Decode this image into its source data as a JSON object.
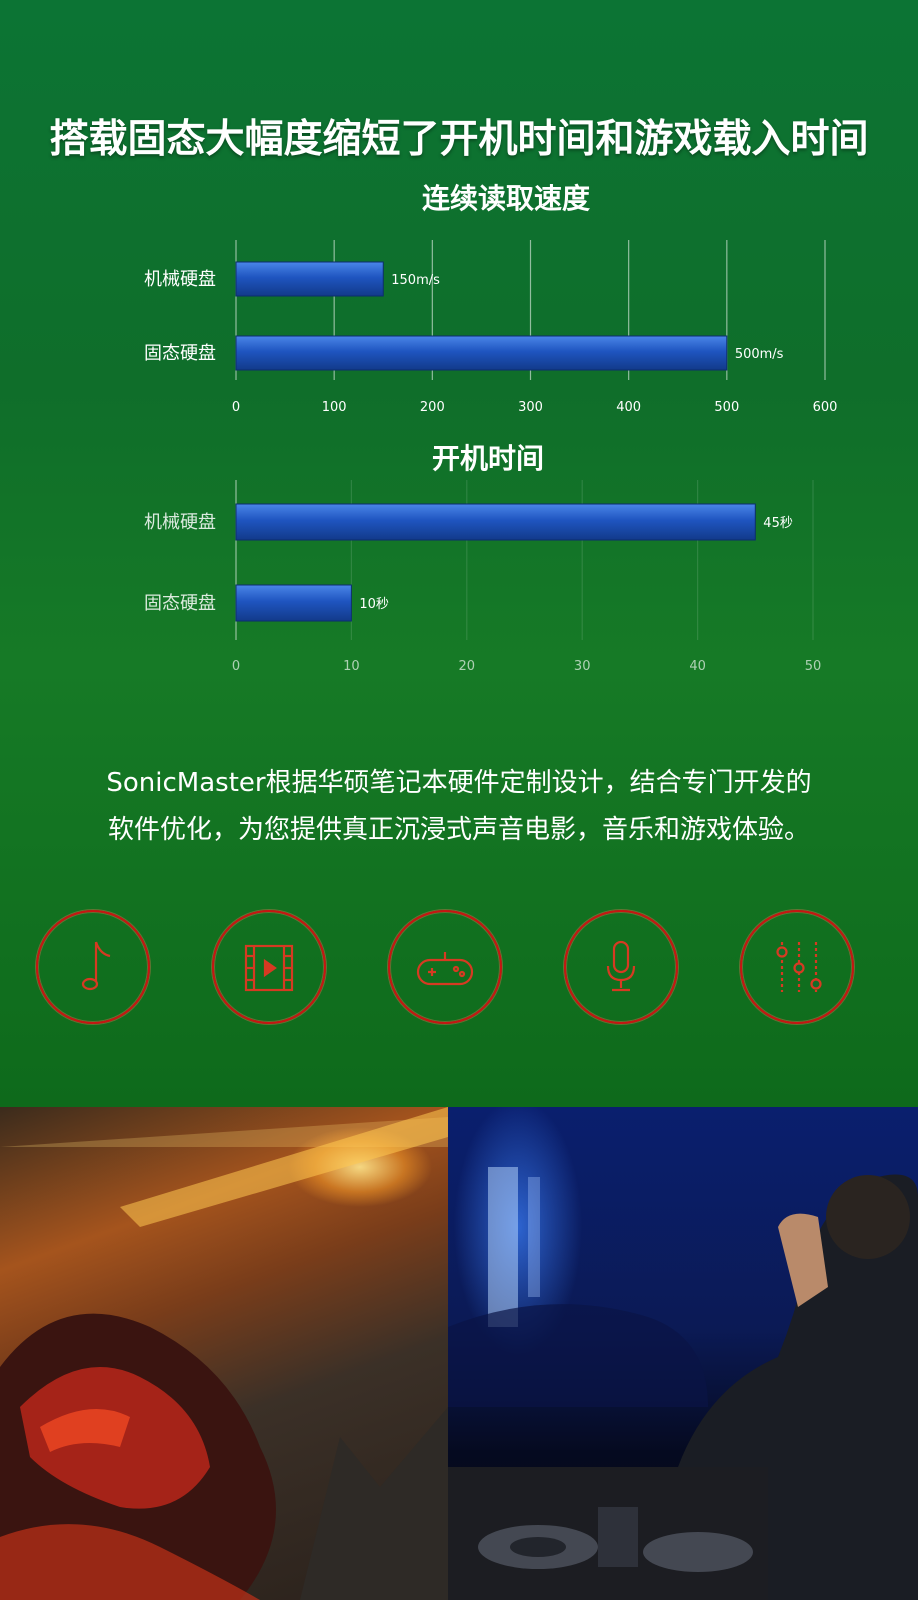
{
  "headline": "搭载固态大幅度缩短了开机时间和游戏载入时间",
  "chart_data": [
    {
      "type": "bar",
      "orientation": "horizontal",
      "title": "连续读取速度",
      "categories": [
        "机械硬盘",
        "固态硬盘"
      ],
      "values": [
        150,
        500
      ],
      "value_labels": [
        "150m/s",
        "500m/s"
      ],
      "xlim": [
        0,
        600
      ],
      "ticks": [
        "0",
        "100",
        "200",
        "300",
        "400",
        "500",
        "600"
      ],
      "bar_color": "#1f55c0",
      "grid": true
    },
    {
      "type": "bar",
      "orientation": "horizontal",
      "title": "开机时间",
      "categories": [
        "机械硬盘",
        "固态硬盘"
      ],
      "values": [
        45,
        10
      ],
      "value_labels": [
        "45秒",
        "10秒"
      ],
      "xlim": [
        0,
        50
      ],
      "ticks": [
        "0",
        "10",
        "20",
        "30",
        "40",
        "50"
      ],
      "bar_color": "#1f55c0",
      "grid": true
    }
  ],
  "description": {
    "line1": "SonicMaster根据华硕笔记本硬件定制设计，结合专门开发的",
    "line2": "软件优化，为您提供真正沉浸式声音电影，音乐和游戏体验。"
  },
  "icons": [
    "music-note-icon",
    "film-icon",
    "gamepad-icon",
    "microphone-icon",
    "equalizer-icon"
  ],
  "colors": {
    "background": "#0f6e2a",
    "icon_ring": "#c81512",
    "icon_stroke": "#d63a22"
  }
}
